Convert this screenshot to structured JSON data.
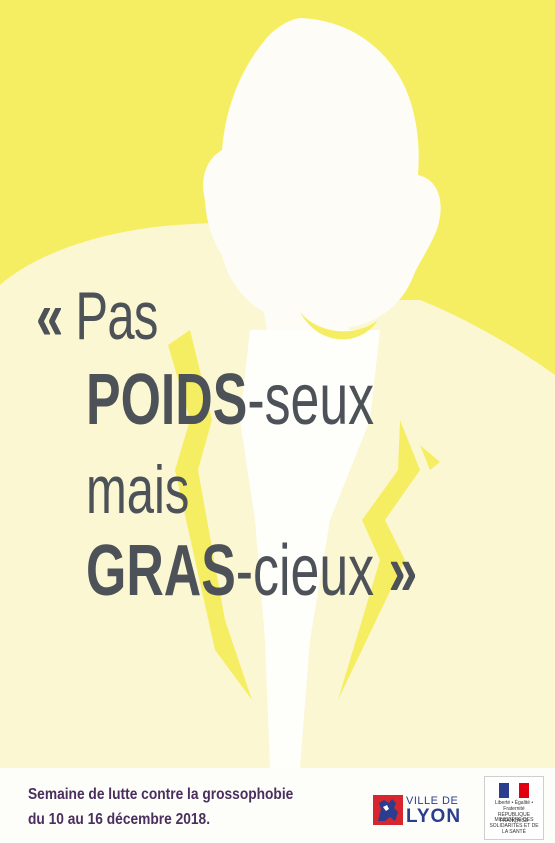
{
  "colors": {
    "background_yellow": "#f6ee62",
    "silhouette": "#fcfbf2",
    "jacket": "#fbf7d2",
    "quote_text": "#4d5258",
    "footer_text": "#4a2f5e",
    "lyon_blue": "#2b3d8f",
    "lyon_red": "#d7262e"
  },
  "quote": {
    "open_mark": "«",
    "line1": "Pas",
    "line2_bold": "POIDS",
    "line2_rest": "-seux",
    "line3": "mais",
    "line4_bold": "GRAS",
    "line4_rest": "-cieux",
    "close_mark": "»"
  },
  "footer": {
    "line1": "Semaine de lutte  contre la grossophobie",
    "line2": "du 10 au 16 décembre 2018."
  },
  "logos": {
    "lyon_small": "VILLE DE",
    "lyon_big": "LYON",
    "ministere_line1": "Liberté • Égalité • Fraternité RÉPUBLIQUE FRANÇAISE",
    "ministere_line2": "MINISTÈRE DES SOLIDARITÉS ET DE LA SANTÉ"
  }
}
